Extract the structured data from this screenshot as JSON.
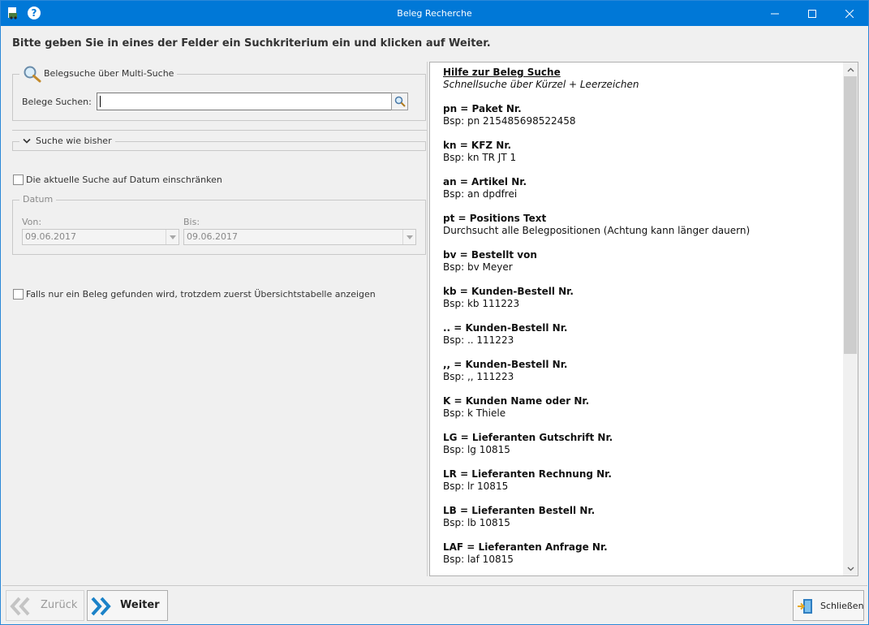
{
  "window": {
    "title": "Beleg Recherche",
    "accent_color": "#0078d7",
    "icons": [
      "app-icon",
      "help-icon",
      "minimize-icon",
      "maximize-icon",
      "close-icon"
    ]
  },
  "heading": "Bitte geben Sie in eines der Felder ein Suchkriterium ein und klicken auf Weiter.",
  "multi_search": {
    "legend": "Belegsuche über Multi-Suche",
    "label": "Belege Suchen:",
    "value": "",
    "icon": "magnifier-icon"
  },
  "classic_search": {
    "legend": "Suche wie bisher",
    "icon": "chevron-down-icon"
  },
  "date_filter": {
    "checkbox_label": "Die aktuelle Suche auf Datum einschränken",
    "checked": false,
    "group_legend": "Datum",
    "from_label": "Von:",
    "from_value": "09.06.2017",
    "to_label": "Bis:",
    "to_value": "09.06.2017"
  },
  "overview": {
    "checkbox_label": "Falls nur ein Beleg gefunden wird, trotzdem zuerst Übersichtstabelle anzeigen",
    "checked": false
  },
  "help": {
    "title": "Hilfe zur Beleg Suche",
    "subtitle": "Schnellsuche über Kürzel + Leerzeichen",
    "entries": [
      {
        "title": "pn = Paket Nr.",
        "example": "Bsp: pn 215485698522458"
      },
      {
        "title": "kn = KFZ Nr.",
        "example": "Bsp: kn TR JT 1"
      },
      {
        "title": "an = Artikel Nr.",
        "example": "Bsp: an dpdfrei"
      },
      {
        "title": "pt = Positions Text",
        "example": "Durchsucht alle Belegpositionen (Achtung kann länger dauern)"
      },
      {
        "title": "bv = Bestellt von",
        "example": "Bsp: bv Meyer"
      },
      {
        "title": "kb = Kunden-Bestell Nr.",
        "example": "Bsp: kb 111223"
      },
      {
        "title": ".. = Kunden-Bestell Nr.",
        "example": "Bsp: .. 111223"
      },
      {
        "title": ",, = Kunden-Bestell Nr.",
        "example": "Bsp: ,, 111223"
      },
      {
        "title": "K = Kunden Name oder Nr.",
        "example": "Bsp: k Thiele"
      },
      {
        "title": "LG = Lieferanten Gutschrift Nr.",
        "example": "Bsp: lg 10815"
      },
      {
        "title": "LR = Lieferanten Rechnung Nr.",
        "example": "Bsp: lr 10815"
      },
      {
        "title": "LB = Lieferanten Bestell Nr.",
        "example": "Bsp: lb 10815"
      },
      {
        "title": "LAF = Lieferanten Anfrage Nr.",
        "example": "Bsp: laf 10815"
      }
    ]
  },
  "footer": {
    "back_label": "Zurück",
    "back_enabled": false,
    "next_label": "Weiter",
    "close_label": "Schließen",
    "back_icon": "double-chevron-left-icon",
    "next_icon": "double-chevron-right-icon",
    "close_icon": "exit-door-icon"
  }
}
